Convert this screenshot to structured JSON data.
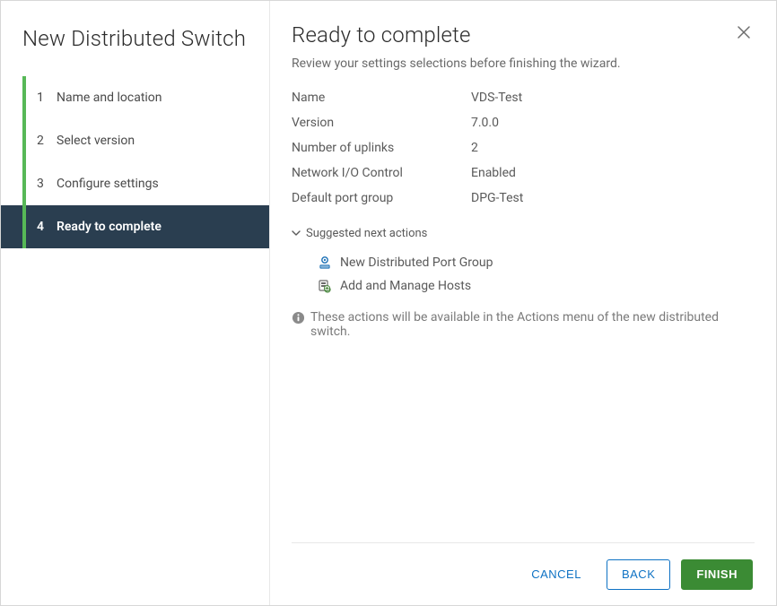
{
  "sidebar": {
    "title": "New Distributed Switch",
    "steps": [
      {
        "num": "1",
        "label": "Name and location",
        "state": "completed"
      },
      {
        "num": "2",
        "label": "Select version",
        "state": "completed"
      },
      {
        "num": "3",
        "label": "Configure settings",
        "state": "completed"
      },
      {
        "num": "4",
        "label": "Ready to complete",
        "state": "active"
      }
    ]
  },
  "main": {
    "title": "Ready to complete",
    "subtitle": "Review your settings selections before finishing the wizard.",
    "summary": [
      {
        "k": "Name",
        "v": "VDS-Test"
      },
      {
        "k": "Version",
        "v": "7.0.0"
      },
      {
        "k": "Number of uplinks",
        "v": "2"
      },
      {
        "k": "Network I/O Control",
        "v": "Enabled"
      },
      {
        "k": "Default port group",
        "v": "DPG-Test"
      }
    ],
    "next_actions_label": "Suggested next actions",
    "next_actions": [
      {
        "icon": "portgroup-icon",
        "label": "New Distributed Port Group"
      },
      {
        "icon": "hosts-icon",
        "label": "Add and Manage Hosts"
      }
    ],
    "info_note": "These actions will be available in the Actions menu of the new distributed switch."
  },
  "footer": {
    "cancel": "CANCEL",
    "back": "BACK",
    "finish": "FINISH"
  }
}
